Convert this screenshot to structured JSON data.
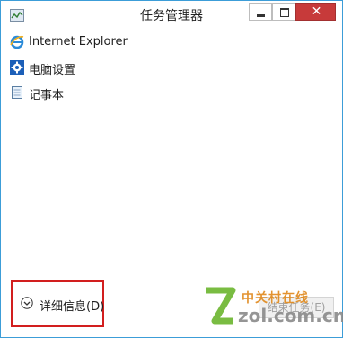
{
  "window": {
    "title": "任务管理器",
    "close_symbol": "✕"
  },
  "apps": [
    {
      "label": "Internet Explorer",
      "icon": "ie-icon"
    },
    {
      "label": "电脑设置",
      "icon": "settings-gear-icon"
    },
    {
      "label": "记事本",
      "icon": "notepad-icon"
    }
  ],
  "footer": {
    "details_label": "详细信息(D)",
    "end_task_label": "结束任务(E)"
  },
  "watermark": {
    "cn": "中关村在线",
    "en": "zol.com.cn"
  },
  "colors": {
    "accent_border": "#3c9dd8",
    "close_button": "#c73a3a",
    "highlight_box": "#d21e1e"
  }
}
